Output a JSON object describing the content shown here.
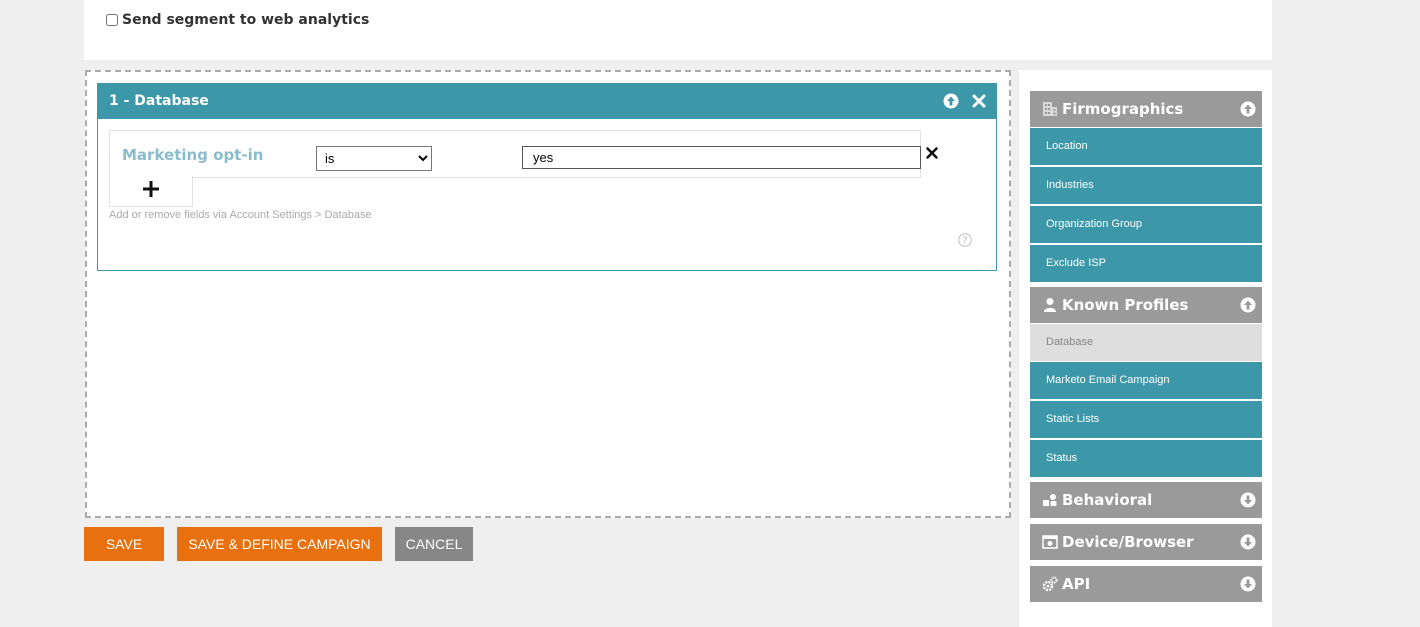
{
  "top": {
    "send_segment_label": "Send segment to web analytics",
    "send_segment_checked": false
  },
  "rule": {
    "title": "1 - Database",
    "field_name": "Marketing opt-in",
    "operator": "is",
    "operator_options": [
      "is"
    ],
    "value": "yes",
    "hint": "Add or remove fields via Account Settings > Database"
  },
  "buttons": {
    "save": "SAVE",
    "save_define": "SAVE & DEFINE CAMPAIGN",
    "cancel": "CANCEL"
  },
  "sidebar": {
    "categories": [
      {
        "label": "Firmographics",
        "icon": "building-icon",
        "expanded": true,
        "items": [
          "Location",
          "Industries",
          "Organization Group",
          "Exclude ISP"
        ]
      },
      {
        "label": "Known Profiles",
        "icon": "person-icon",
        "expanded": true,
        "items": [
          "Database",
          "Marketo Email Campaign",
          "Static Lists",
          "Status"
        ]
      },
      {
        "label": "Behavioral",
        "icon": "behavior-icon",
        "expanded": false,
        "items": []
      },
      {
        "label": "Device/Browser",
        "icon": "device-icon",
        "expanded": false,
        "items": []
      },
      {
        "label": "API",
        "icon": "gears-icon",
        "expanded": false,
        "items": []
      }
    ]
  },
  "colors": {
    "teal": "#3c98a8",
    "orange": "#e8700e",
    "gray": "#9a9a9a"
  }
}
